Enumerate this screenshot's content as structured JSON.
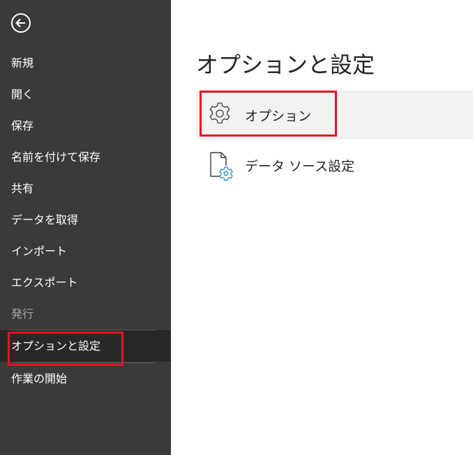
{
  "sidebar": {
    "back_icon": "back-arrow-icon",
    "items": [
      {
        "label": "新規"
      },
      {
        "label": "開く"
      },
      {
        "label": "保存"
      },
      {
        "label": "名前を付けて保存"
      },
      {
        "label": "共有"
      },
      {
        "label": "データを取得"
      },
      {
        "label": "インポート"
      },
      {
        "label": "エクスポート"
      },
      {
        "label": "発行"
      },
      {
        "label": "オプションと設定"
      },
      {
        "label": "作業の開始"
      }
    ],
    "bg_color": "#3b3a39",
    "selected_bg_color": "#292827"
  },
  "main": {
    "title": "オプションと設定",
    "options": [
      {
        "label": "オプション",
        "icon": "gear-icon"
      },
      {
        "label": "データ ソース設定",
        "icon": "data-source-settings-icon"
      }
    ]
  },
  "highlight_color": "#e81123"
}
